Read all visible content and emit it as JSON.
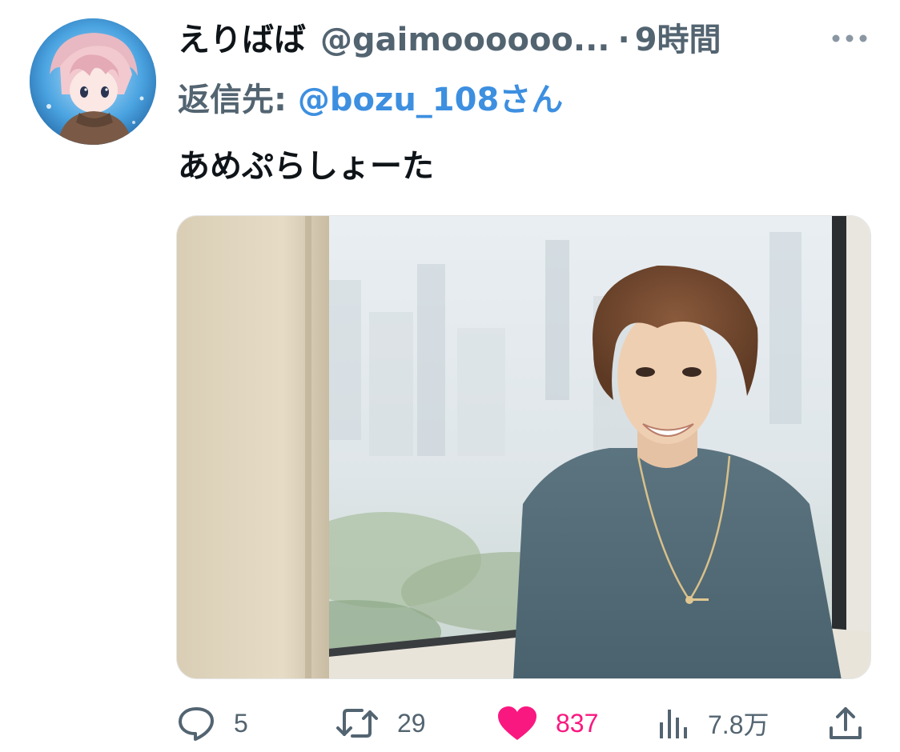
{
  "tweet": {
    "display_name": "えりばば",
    "handle": "@gaimoooooo...",
    "separator": "·",
    "time": "9時間",
    "reply_prefix": "返信先: ",
    "reply_target": "@bozu_108さん",
    "text": "あめぷらしょーた",
    "media_icon": "photo-of-smiling-man-in-blue-shirt-by-window"
  },
  "actions": {
    "reply_count": "5",
    "retweet_count": "29",
    "like_count": "837",
    "views_count": "7.8万",
    "like_active": true
  },
  "icons": {
    "more": "more-horizontal-icon",
    "reply": "speech-bubble-icon",
    "retweet": "retweet-arrows-icon",
    "like": "heart-filled-icon",
    "views": "bar-chart-icon",
    "share": "share-upload-icon"
  },
  "colors": {
    "text_primary": "#0f1419",
    "text_secondary": "#536471",
    "link": "#3d8fe0",
    "like": "#f91880"
  }
}
